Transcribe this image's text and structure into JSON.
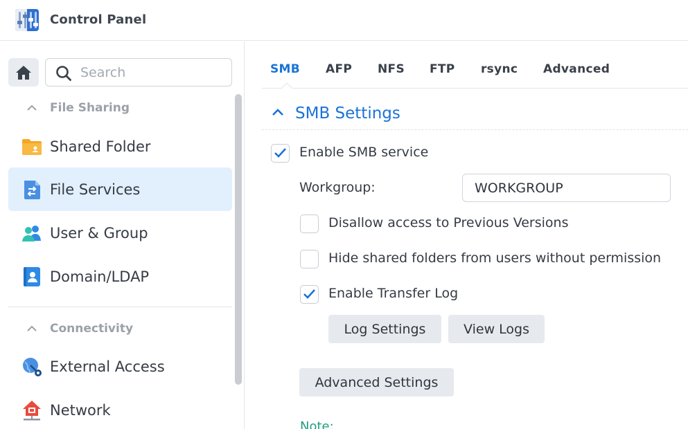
{
  "window": {
    "title": "Control Panel",
    "icon": "control-panel-icon"
  },
  "sidebar": {
    "search": {
      "placeholder": "Search",
      "value": ""
    },
    "sections": [
      {
        "label": "File Sharing",
        "expanded": true
      },
      {
        "label": "Connectivity",
        "expanded": true
      }
    ],
    "items": [
      {
        "label": "Shared Folder",
        "icon": "folder-icon"
      },
      {
        "label": "File Services",
        "icon": "file-services-icon",
        "active": true
      },
      {
        "label": "User & Group",
        "icon": "users-icon"
      },
      {
        "label": "Domain/LDAP",
        "icon": "domain-ldap-icon"
      },
      {
        "label": "External Access",
        "icon": "external-access-icon"
      },
      {
        "label": "Network",
        "icon": "network-icon"
      }
    ]
  },
  "tabs": [
    {
      "label": "SMB",
      "active": true
    },
    {
      "label": "AFP"
    },
    {
      "label": "NFS"
    },
    {
      "label": "FTP"
    },
    {
      "label": "rsync"
    },
    {
      "label": "Advanced"
    }
  ],
  "smb": {
    "section_title": "SMB Settings",
    "enable_smb": {
      "label": "Enable SMB service",
      "checked": true
    },
    "workgroup": {
      "label": "Workgroup:",
      "value": "WORKGROUP"
    },
    "disallow_previous": {
      "label": "Disallow access to Previous Versions",
      "checked": false
    },
    "hide_shared": {
      "label": "Hide shared folders from users without permission",
      "checked": false
    },
    "transfer_log": {
      "label": "Enable Transfer Log",
      "checked": true
    },
    "log_settings_label": "Log Settings",
    "view_logs_label": "View Logs",
    "advanced_settings_label": "Advanced Settings",
    "note_label": "Note:"
  },
  "colors": {
    "accent": "#1a73d6",
    "active_bg": "#e2effd",
    "note": "#1e9e7e"
  }
}
